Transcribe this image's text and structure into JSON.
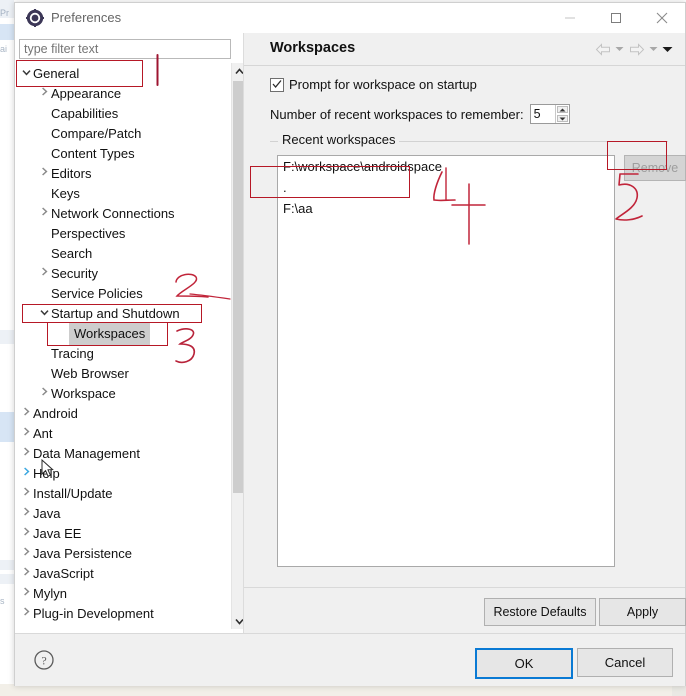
{
  "window": {
    "title": "Preferences",
    "icon": "eclipse-preferences-icon",
    "controls": {
      "minimize": "minimize-icon",
      "maximize": "maximize-icon",
      "close": "close-icon"
    }
  },
  "colors": {
    "annotation_red": "#b61826",
    "focus_blue": "#0a7ad4",
    "selection_gray": "#cdcdcd",
    "dialog_bg": "#f0f0f0",
    "disabled_text": "#9e9e9e"
  },
  "sidebar": {
    "filter": {
      "placeholder": "type filter text",
      "value": ""
    },
    "items": [
      {
        "label": "General",
        "indent": 0,
        "twisty": "down",
        "selected": false
      },
      {
        "label": "Appearance",
        "indent": 1,
        "twisty": "right",
        "selected": false
      },
      {
        "label": "Capabilities",
        "indent": 1,
        "twisty": "none",
        "selected": false
      },
      {
        "label": "Compare/Patch",
        "indent": 1,
        "twisty": "none",
        "selected": false
      },
      {
        "label": "Content Types",
        "indent": 1,
        "twisty": "none",
        "selected": false
      },
      {
        "label": "Editors",
        "indent": 1,
        "twisty": "right",
        "selected": false
      },
      {
        "label": "Keys",
        "indent": 1,
        "twisty": "none",
        "selected": false
      },
      {
        "label": "Network Connections",
        "indent": 1,
        "twisty": "right",
        "selected": false
      },
      {
        "label": "Perspectives",
        "indent": 1,
        "twisty": "none",
        "selected": false
      },
      {
        "label": "Search",
        "indent": 1,
        "twisty": "none",
        "selected": false
      },
      {
        "label": "Security",
        "indent": 1,
        "twisty": "right",
        "selected": false
      },
      {
        "label": "Service Policies",
        "indent": 1,
        "twisty": "none",
        "selected": false
      },
      {
        "label": "Startup and Shutdown",
        "indent": 1,
        "twisty": "down",
        "selected": false
      },
      {
        "label": "Workspaces",
        "indent": 2,
        "twisty": "none",
        "selected": true
      },
      {
        "label": "Tracing",
        "indent": 1,
        "twisty": "none",
        "selected": false
      },
      {
        "label": "Web Browser",
        "indent": 1,
        "twisty": "none",
        "selected": false
      },
      {
        "label": "Workspace",
        "indent": 1,
        "twisty": "right",
        "selected": false
      },
      {
        "label": "Android",
        "indent": 0,
        "twisty": "right",
        "selected": false
      },
      {
        "label": "Ant",
        "indent": 0,
        "twisty": "right",
        "selected": false
      },
      {
        "label": "Data Management",
        "indent": 0,
        "twisty": "right",
        "selected": false
      },
      {
        "label": "Help",
        "indent": 0,
        "twisty": "right-blue",
        "selected": false
      },
      {
        "label": "Install/Update",
        "indent": 0,
        "twisty": "right",
        "selected": false
      },
      {
        "label": "Java",
        "indent": 0,
        "twisty": "right",
        "selected": false
      },
      {
        "label": "Java EE",
        "indent": 0,
        "twisty": "right",
        "selected": false
      },
      {
        "label": "Java Persistence",
        "indent": 0,
        "twisty": "right",
        "selected": false
      },
      {
        "label": "JavaScript",
        "indent": 0,
        "twisty": "right",
        "selected": false
      },
      {
        "label": "Mylyn",
        "indent": 0,
        "twisty": "right",
        "selected": false
      },
      {
        "label": "Plug-in Development",
        "indent": 0,
        "twisty": "right",
        "selected": false
      }
    ],
    "scrollbar": {
      "up": "chevron-up-icon",
      "down": "chevron-down-icon"
    }
  },
  "page": {
    "title": "Workspaces",
    "nav": {
      "back": "back-arrow-icon",
      "back_menu": "chevron-down-icon",
      "forward": "forward-arrow-icon",
      "forward_menu": "chevron-down-icon",
      "view_menu": "chevron-down-icon"
    },
    "prompt_checkbox": {
      "label": "Prompt for workspace on startup",
      "checked": true
    },
    "recent_count": {
      "label": "Number of recent workspaces to remember:",
      "value": "5",
      "up": "spinner-up-icon",
      "down": "spinner-down-icon"
    },
    "group": {
      "label": "Recent workspaces",
      "entries": [
        "F:\\workspace\\androidspace",
        ".",
        "F:\\aa"
      ],
      "remove_button": {
        "label": "Remove",
        "enabled": false
      }
    },
    "footer_buttons": [
      {
        "label": "Restore Defaults"
      },
      {
        "label": "Apply"
      }
    ]
  },
  "dialog_footer": {
    "help": "help-icon",
    "ok": "OK",
    "cancel": "Cancel"
  },
  "annotations": {
    "marks": [
      "1",
      "2",
      "3",
      "4",
      "5"
    ],
    "boxes": [
      "General",
      "Startup and Shutdown",
      "Workspaces",
      "recent-workspaces-entries",
      "Remove"
    ]
  },
  "backdrop": {
    "fragments": [
      "Pr",
      "ai",
      "s"
    ]
  }
}
